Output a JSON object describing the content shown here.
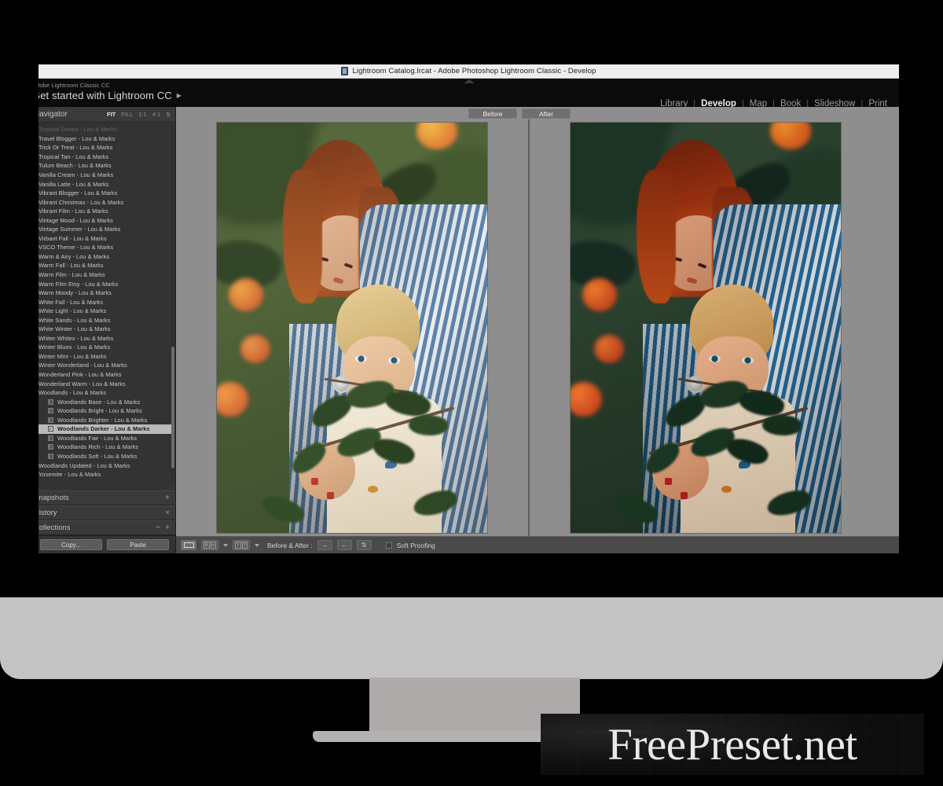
{
  "window": {
    "title": "Lightroom Catalog.lrcat - Adobe Photoshop Lightroom Classic - Develop",
    "title_icon": "lightroom-catalog-icon"
  },
  "identity": {
    "product": "Adobe Lightroom Classic CC",
    "cta": "Get started with Lightroom CC",
    "cta_arrow": "▶"
  },
  "modules": {
    "items": [
      {
        "label": "Library",
        "active": false
      },
      {
        "label": "Develop",
        "active": true
      },
      {
        "label": "Map",
        "active": false
      },
      {
        "label": "Book",
        "active": false
      },
      {
        "label": "Slideshow",
        "active": false
      },
      {
        "label": "Print",
        "active": false
      }
    ],
    "separator": "|"
  },
  "navigator": {
    "title": "Navigator",
    "zoom_levels": [
      {
        "label": "FIT",
        "active": true
      },
      {
        "label": "FILL",
        "active": false
      },
      {
        "label": "1:1",
        "active": false
      },
      {
        "label": "4:1",
        "active": false
      }
    ],
    "chevron": "⇅"
  },
  "presets": {
    "items": [
      {
        "label": "Tropical Dream - Lou & Marks",
        "child": false,
        "selected": false,
        "cut": true
      },
      {
        "label": "Travel Blogger - Lou & Marks",
        "child": false,
        "selected": false
      },
      {
        "label": "Trick Or Treat - Lou & Marks",
        "child": false,
        "selected": false
      },
      {
        "label": "Tropical Tan - Lou & Marks",
        "child": false,
        "selected": false
      },
      {
        "label": "Tulum Beach - Lou & Marks",
        "child": false,
        "selected": false
      },
      {
        "label": "Vanilla Cream - Lou & Marks",
        "child": false,
        "selected": false
      },
      {
        "label": "Vanilla Latte - Lou & Marks",
        "child": false,
        "selected": false
      },
      {
        "label": "Vibrant Blogger - Lou & Marks",
        "child": false,
        "selected": false
      },
      {
        "label": "Vibrant Christmas - Lou & Marks",
        "child": false,
        "selected": false
      },
      {
        "label": "Vibrant Film - Lou & Marks",
        "child": false,
        "selected": false
      },
      {
        "label": "Vintage Mood - Lou & Marks",
        "child": false,
        "selected": false
      },
      {
        "label": "Vintage Summer - Lou & Marks",
        "child": false,
        "selected": false
      },
      {
        "label": "Virbant Fall - Lou & Marks",
        "child": false,
        "selected": false
      },
      {
        "label": "VSCO Theme - Lou & Marks",
        "child": false,
        "selected": false
      },
      {
        "label": "Warm & Airy - Lou & Marks",
        "child": false,
        "selected": false
      },
      {
        "label": "Warm Fall - Lou & Marks",
        "child": false,
        "selected": false
      },
      {
        "label": "Warm Film - Lou & Marks",
        "child": false,
        "selected": false
      },
      {
        "label": "Warm Film Etsy - Lou & Marks",
        "child": false,
        "selected": false
      },
      {
        "label": "Warm Moody - Lou & Marks",
        "child": false,
        "selected": false
      },
      {
        "label": "White Fall - Lou & Marks",
        "child": false,
        "selected": false
      },
      {
        "label": "White Light - Lou & Marks",
        "child": false,
        "selected": false
      },
      {
        "label": "White Sands - Lou & Marks",
        "child": false,
        "selected": false
      },
      {
        "label": "White Winter - Lou & Marks",
        "child": false,
        "selected": false
      },
      {
        "label": "Whiter Whites - Lou & Marks",
        "child": false,
        "selected": false
      },
      {
        "label": "Winter Blues - Lou & Marks",
        "child": false,
        "selected": false
      },
      {
        "label": "Winter Mint - Lou & Marks",
        "child": false,
        "selected": false
      },
      {
        "label": "Winter Wonderland - Lou & Marks",
        "child": false,
        "selected": false
      },
      {
        "label": "Wonderland Pink - Lou & Marks",
        "child": false,
        "selected": false
      },
      {
        "label": "Wonderland Warm - Lou & Marks",
        "child": false,
        "selected": false
      },
      {
        "label": "Woodlands - Lou & Marks",
        "child": false,
        "selected": false
      },
      {
        "label": "Woodlands Base - Lou & Marks",
        "child": true,
        "selected": false
      },
      {
        "label": "Woodlands Bright - Lou & Marks",
        "child": true,
        "selected": false
      },
      {
        "label": "Woodlands Brighter - Lou & Marks",
        "child": true,
        "selected": false
      },
      {
        "label": "Woodlands Darker - Lou & Marks",
        "child": true,
        "selected": true
      },
      {
        "label": "Woodlands Fair - Lou & Marks",
        "child": true,
        "selected": false
      },
      {
        "label": "Woodlands Rich - Lou & Marks",
        "child": true,
        "selected": false
      },
      {
        "label": "Woodlands Soft - Lou & Marks",
        "child": true,
        "selected": false
      },
      {
        "label": "Woodlands Updated - Lou & Marks",
        "child": false,
        "selected": false
      },
      {
        "label": "Yosemite - Lou & Marks",
        "child": false,
        "selected": false
      }
    ]
  },
  "left_panels": [
    {
      "title": "Snapshots",
      "controls": [
        "+"
      ]
    },
    {
      "title": "History",
      "controls": [
        "×"
      ]
    },
    {
      "title": "Collections",
      "controls": [
        "−",
        "+"
      ]
    }
  ],
  "actions": {
    "copy_label": "Copy...",
    "paste_label": "Paste"
  },
  "compare": {
    "before_label": "Before",
    "after_label": "After"
  },
  "toolbar": {
    "view_loupe": "loupe-view-icon",
    "view_before_after": "before-after-view-icon",
    "view_split": "split-view-icon",
    "before_after_label": "Before & After :",
    "swap_buttons": [
      {
        "name": "copy-before-settings-button",
        "glyph": "→"
      },
      {
        "name": "copy-after-settings-button",
        "glyph": "←"
      },
      {
        "name": "swap-before-after-button",
        "glyph": "⇅"
      }
    ],
    "soft_proofing_label": "Soft Proofing",
    "soft_proofing_checked": false
  },
  "watermark": {
    "text": "FreePreset.net"
  },
  "colors": {
    "panel_bg": "#333333",
    "app_bg": "#2b2b2b",
    "canvas_bg": "#8e8e8e",
    "highlight": "#b9b9b9",
    "monitor": "#c3c3c3"
  }
}
